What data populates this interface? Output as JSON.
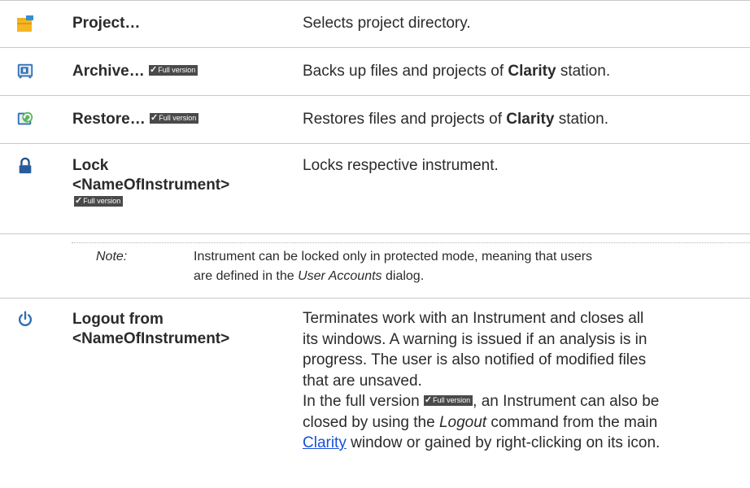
{
  "badge": {
    "label": "Full version",
    "check": "✓"
  },
  "rows": [
    {
      "command": "Project…",
      "description": "Selects project directory.",
      "icon": "folder-project-icon"
    },
    {
      "command": "Archive…",
      "description_before": "Backs up files and projects of ",
      "description_bold": "Clarity",
      "description_after": " station.",
      "icon": "archive-icon"
    },
    {
      "command": "Restore…",
      "description_before": "Restores files and projects of ",
      "description_bold": "Clarity",
      "description_after": " station.",
      "icon": "restore-icon"
    },
    {
      "command_line1": "Lock",
      "command_line2": "<NameOfInstrument>",
      "description": "Locks respective instrument.",
      "icon": "lock-icon"
    },
    {
      "command_line1": "Logout from",
      "command_line2": "<NameOfInstrument>",
      "icon": "power-icon",
      "desc_l1": "Terminates work with an Instrument and closes all",
      "desc_l2": "its windows. A warning is issued if an analysis is in",
      "desc_l3": "progress. The user is also notified of modified files",
      "desc_l4": "that are unsaved.",
      "desc_l5_before": "In the full version ",
      "desc_l5_after": ", an Instrument can also be",
      "desc_l6_before": "closed by using the ",
      "desc_l6_italic": "Logout",
      "desc_l6_after": " command from the main",
      "desc_l7_link": "Clarity",
      "desc_l7_after": " window or gained by right-clicking on its icon."
    }
  ],
  "note": {
    "label": "Note:",
    "line1": "Instrument can be locked only in protected mode, meaning that users",
    "line2_before": "are defined in the ",
    "line2_italic": "User Accounts",
    "line2_after": " dialog."
  },
  "colors": {
    "rule": "#c9c9c9",
    "folder": "#f2b01e",
    "icon_blue": "#2f6fb5",
    "lock_dark": "#1f4f8a",
    "link": "#1a4fd6",
    "badge_bg": "#4a4a4a"
  }
}
